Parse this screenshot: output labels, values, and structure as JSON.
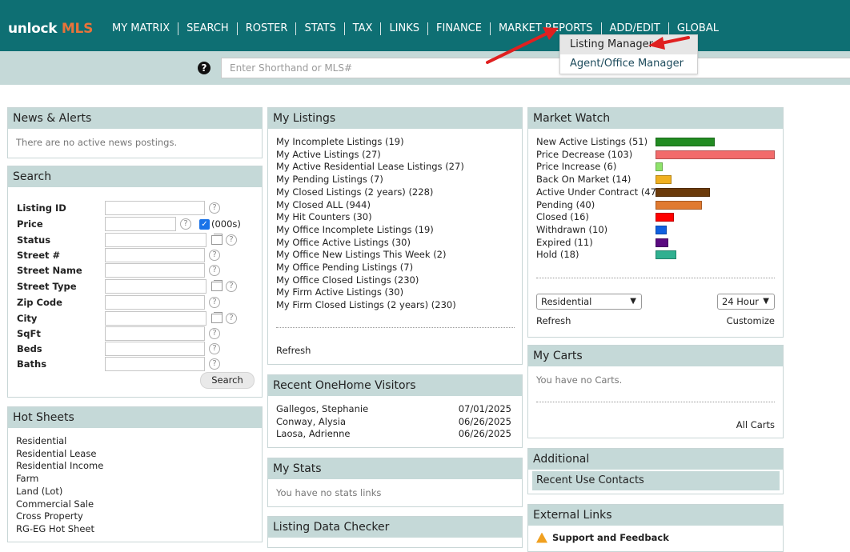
{
  "brand": {
    "part1": "unlock ",
    "part2": "MLS",
    "accent": "#e9733a",
    "bar_color": "#0e6f73"
  },
  "nav": [
    "MY MATRIX",
    "SEARCH",
    "ROSTER",
    "STATS",
    "TAX",
    "LINKS",
    "FINANCE",
    "MARKET REPORTS",
    "ADD/EDIT",
    "GLOBAL"
  ],
  "shorthand": {
    "placeholder": "Enter Shorthand or MLS#",
    "help": "?"
  },
  "dropdown": [
    "Listing Manager",
    "Agent/Office Manager"
  ],
  "news": {
    "title": "News & Alerts",
    "message": "There are no active news postings."
  },
  "search": {
    "title": "Search",
    "fields": [
      "Listing ID",
      "Price",
      "Status",
      "Street #",
      "Street Name",
      "Street Type",
      "Zip Code",
      "City",
      "SqFt",
      "Beds",
      "Baths"
    ],
    "price_unit": "(000s)",
    "button": "Search"
  },
  "hot_sheets": {
    "title": "Hot Sheets",
    "items": [
      "Residential",
      "Residential Lease",
      "Residential Income",
      "Farm",
      "Land (Lot)",
      "Commercial Sale",
      "Cross Property",
      "RG-EG Hot Sheet"
    ]
  },
  "my_listings": {
    "title": "My Listings",
    "items": [
      "My Incomplete Listings (19)",
      "My Active Listings (27)",
      "My Active Residential Lease Listings (27)",
      "My Pending Listings (7)",
      "My Closed Listings (2 years) (228)",
      "My Closed ALL (944)",
      "My Hit Counters (30)",
      "My Office Incomplete Listings (19)",
      "My Office Active Listings (30)",
      "My Office New Listings This Week (2)",
      "My Office Pending Listings (7)",
      "My Office Closed Listings (230)",
      "My Firm Active Listings (30)",
      "My Firm Closed Listings (2 years) (230)"
    ],
    "refresh": "Refresh"
  },
  "visitors": {
    "title": "Recent OneHome Visitors",
    "rows": [
      {
        "name": "Gallegos, Stephanie",
        "date": "07/01/2025"
      },
      {
        "name": "Conway, Alysia",
        "date": "06/26/2025"
      },
      {
        "name": "Laosa, Adrienne",
        "date": "06/26/2025"
      }
    ]
  },
  "my_stats": {
    "title": "My Stats",
    "message": "You have no stats links"
  },
  "data_checker": {
    "title": "Listing Data Checker"
  },
  "market_watch": {
    "title": "Market Watch",
    "rows": [
      {
        "label": "New Active Listings (51)",
        "value": 51,
        "color": "#228b22"
      },
      {
        "label": "Price Decrease (103)",
        "value": 103,
        "color": "#f26b6b"
      },
      {
        "label": "Price Increase (6)",
        "value": 6,
        "color": "#8fe36b"
      },
      {
        "label": "Back On Market (14)",
        "value": 14,
        "color": "#f0b020"
      },
      {
        "label": "Active Under Contract (47)",
        "value": 47,
        "color": "#6b3a0a"
      },
      {
        "label": "Pending (40)",
        "value": 40,
        "color": "#e07a30"
      },
      {
        "label": "Closed (16)",
        "value": 16,
        "color": "#ff0000"
      },
      {
        "label": "Withdrawn (10)",
        "value": 10,
        "color": "#1060e0"
      },
      {
        "label": "Expired (11)",
        "value": 11,
        "color": "#5a0a80"
      },
      {
        "label": "Hold (18)",
        "value": 18,
        "color": "#30b090"
      }
    ],
    "property_type": "Residential",
    "period": "24 Hour",
    "refresh": "Refresh",
    "customize": "Customize"
  },
  "carts": {
    "title": "My Carts",
    "message": "You have no Carts.",
    "all": "All Carts"
  },
  "additional": {
    "title": "Additional",
    "item": "Recent Use Contacts"
  },
  "external_links": {
    "title": "External Links",
    "item": "Support and Feedback"
  }
}
